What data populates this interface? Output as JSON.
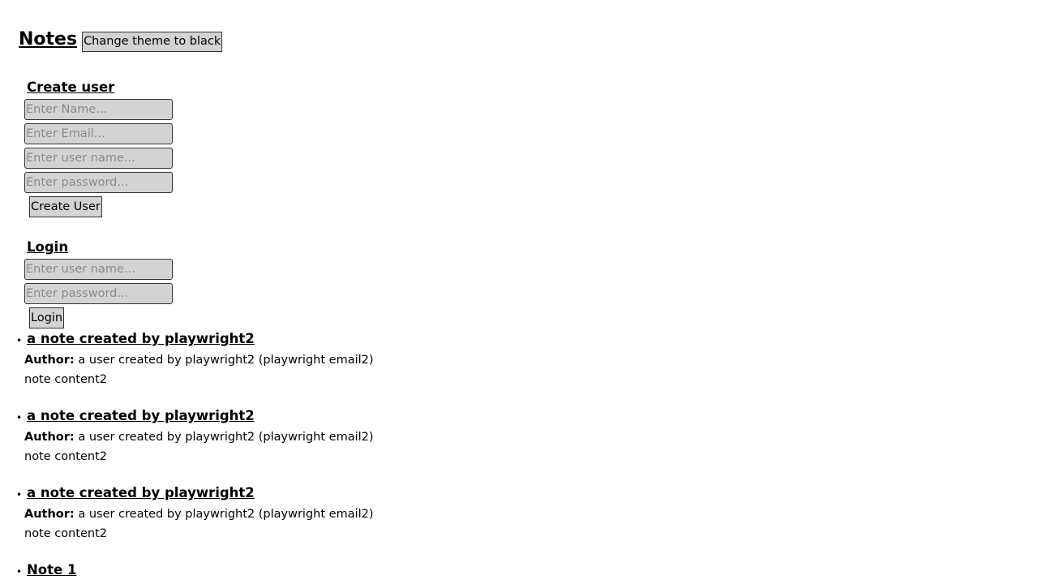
{
  "header": {
    "title": "Notes",
    "theme_button_label": "Change theme to black"
  },
  "create_user": {
    "title": "Create user",
    "name_placeholder": "Enter Name...",
    "email_placeholder": "Enter Email...",
    "username_placeholder": "Enter user name...",
    "password_placeholder": "Enter password...",
    "submit_label": "Create User"
  },
  "login": {
    "title": "Login",
    "username_placeholder": "Enter user name...",
    "password_placeholder": "Enter password...",
    "submit_label": "Login"
  },
  "notes": {
    "author_label": "Author:",
    "items": [
      {
        "title": "a note created by playwright2",
        "author": "a user created by playwright2 (playwright email2)",
        "content": "note content2"
      },
      {
        "title": "a note created by playwright2",
        "author": "a user created by playwright2 (playwright email2)",
        "content": "note content2"
      },
      {
        "title": "a note created by playwright2",
        "author": "a user created by playwright2 (playwright email2)",
        "content": "note content2"
      },
      {
        "title": "Note 1",
        "author": "",
        "content": ""
      }
    ]
  }
}
